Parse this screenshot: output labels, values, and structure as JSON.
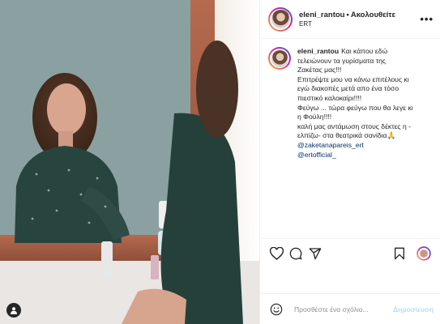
{
  "header": {
    "username": "eleni_rantou",
    "separator": "•",
    "follow_label": "Ακολουθείτε",
    "subtitle": "ERT",
    "more_label": "•••"
  },
  "caption": {
    "username": "eleni_rantou",
    "lines": [
      "Και κάπου εδώ",
      "τελειώνουν τα γυρίσματα της",
      "Ζακέτας μας!!!",
      "Επιτρέψτε μου να κάνω επιτέλους κι",
      "εγώ διακοπές μετά απο ένα τόσο",
      "πιεστικό καλοκαίρι!!!!",
      "Φεύγω ... τώρα φεύγω που θα λεγε κι",
      "η Φούλη!!!!",
      "καλή μας αντάμωση στους δέκτες η -",
      "ελπίζω- στα θεατρικά σανίδια🙏"
    ],
    "mentions": [
      "@zaketanapareis_ert",
      "@ertofficial_"
    ]
  },
  "comment": {
    "placeholder": "Προσθέστε ένα σχόλιο...",
    "post_label": "Δημοσίευση"
  },
  "icons": {
    "like": "heart-icon",
    "comment": "comment-icon",
    "share": "share-icon",
    "save": "bookmark-icon",
    "emoji": "emoji-icon",
    "tag": "user-tag-icon"
  },
  "colors": {
    "mention": "#00376b",
    "post_disabled": "#b2dffc",
    "border": "#efefef"
  }
}
